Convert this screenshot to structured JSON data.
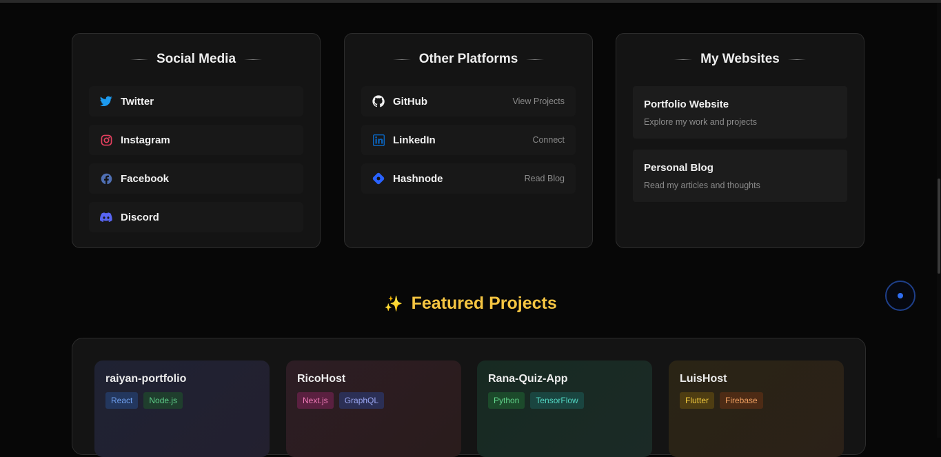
{
  "social": {
    "title": "Social Media",
    "items": [
      {
        "label": "Twitter",
        "icon": "twitter-icon"
      },
      {
        "label": "Instagram",
        "icon": "instagram-icon"
      },
      {
        "label": "Facebook",
        "icon": "facebook-icon"
      },
      {
        "label": "Discord",
        "icon": "discord-icon"
      }
    ]
  },
  "platforms": {
    "title": "Other Platforms",
    "items": [
      {
        "label": "GitHub",
        "hint": "View Projects",
        "icon": "github-icon"
      },
      {
        "label": "LinkedIn",
        "hint": "Connect",
        "icon": "linkedin-icon"
      },
      {
        "label": "Hashnode",
        "hint": "Read Blog",
        "icon": "hashnode-icon"
      }
    ]
  },
  "websites": {
    "title": "My Websites",
    "items": [
      {
        "name": "Portfolio Website",
        "desc": "Explore my work and projects"
      },
      {
        "name": "Personal Blog",
        "desc": "Read my articles and thoughts"
      }
    ]
  },
  "featured": {
    "icon": "✨",
    "title": "Featured Projects"
  },
  "projects": [
    {
      "name": "raiyan-portfolio",
      "tags": [
        "React",
        "Node.js"
      ]
    },
    {
      "name": "RicoHost",
      "tags": [
        "Next.js",
        "GraphQL"
      ]
    },
    {
      "name": "Rana-Quiz-App",
      "tags": [
        "Python",
        "TensorFlow"
      ]
    },
    {
      "name": "LuisHost",
      "tags": [
        "Flutter",
        "Firebase"
      ]
    }
  ],
  "colors": {
    "accent_gold": "#f5c542",
    "twitter": "#1d9bf0",
    "instagram": "#e4405f",
    "facebook": "#4f6fb3",
    "discord": "#5865f2",
    "linkedin": "#0a66c2",
    "hashnode": "#2962ff"
  }
}
